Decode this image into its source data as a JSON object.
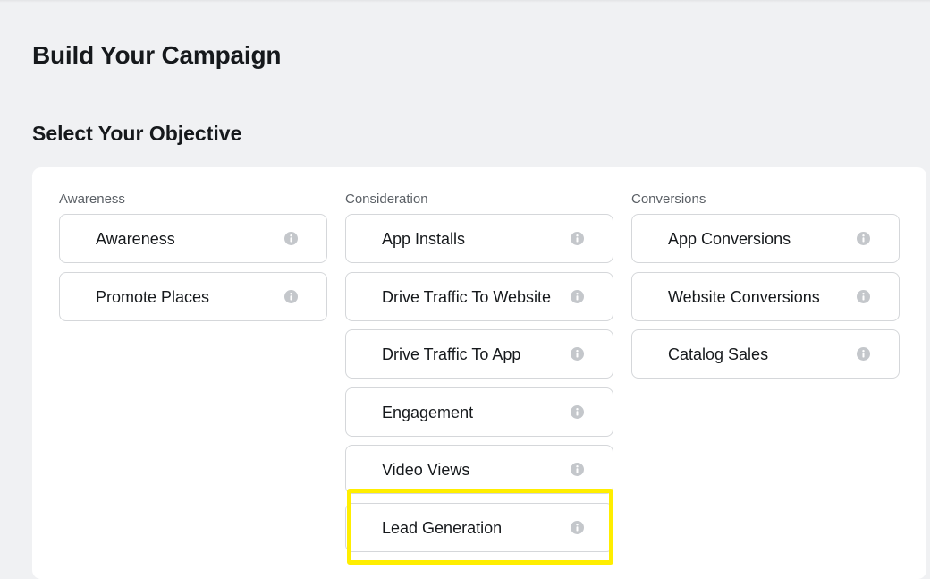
{
  "page_title": "Build Your Campaign",
  "section_title": "Select Your Objective",
  "columns": [
    {
      "header": "Awareness",
      "options": [
        {
          "label": "Awareness"
        },
        {
          "label": "Promote Places"
        }
      ]
    },
    {
      "header": "Consideration",
      "options": [
        {
          "label": "App Installs"
        },
        {
          "label": "Drive Traffic To Website"
        },
        {
          "label": "Drive Traffic To App"
        },
        {
          "label": "Engagement"
        },
        {
          "label": "Video Views"
        },
        {
          "label": "Lead Generation"
        }
      ]
    },
    {
      "header": "Conversions",
      "options": [
        {
          "label": "App Conversions"
        },
        {
          "label": "Website Conversions"
        },
        {
          "label": "Catalog Sales"
        }
      ]
    }
  ],
  "icons": {
    "info": "info-icon"
  },
  "colors": {
    "highlight": "#ffee00",
    "info_icon": "#c4c7cb"
  }
}
